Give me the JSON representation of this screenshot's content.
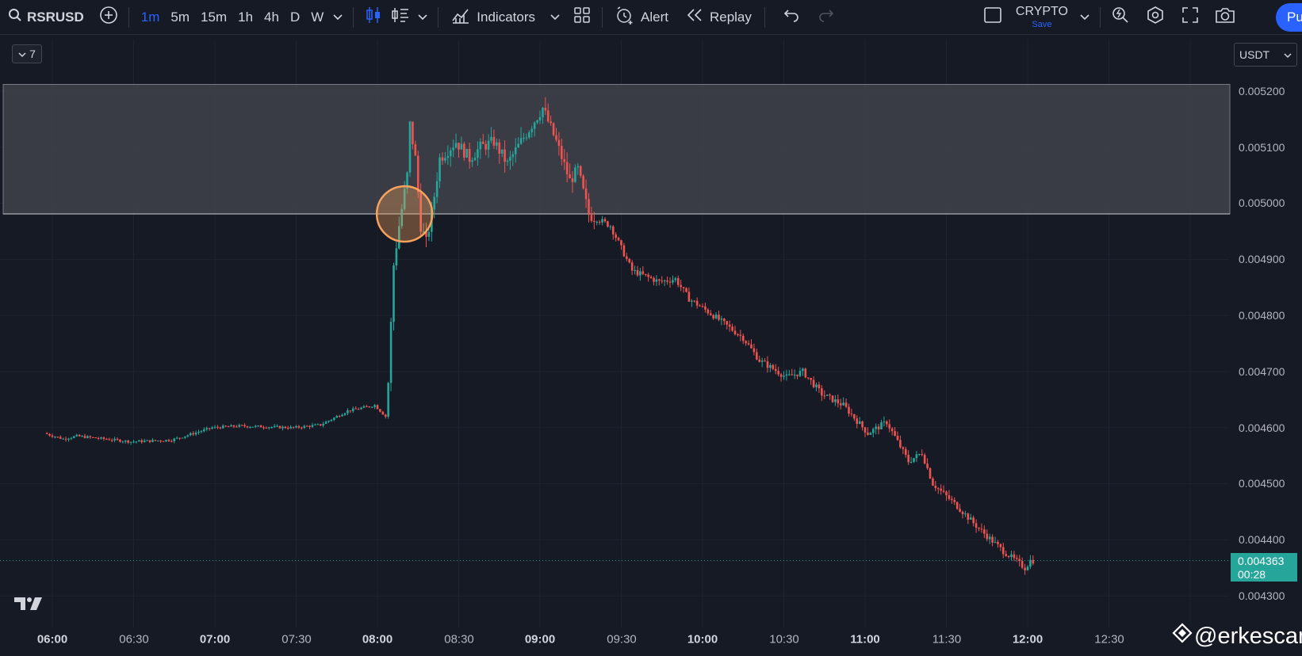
{
  "toolbar": {
    "symbol": "RSRUSD",
    "timeframes": [
      "1m",
      "5m",
      "15m",
      "1h",
      "4h",
      "D",
      "W"
    ],
    "active_timeframe": "1m",
    "indicators_label": "Indicators",
    "alert_label": "Alert",
    "replay_label": "Replay",
    "layout_name": "CRYPTO",
    "save_label": "Save",
    "publish_label": "Pu"
  },
  "legend_toggle": {
    "count": "7"
  },
  "currency_select": {
    "value": "USDT"
  },
  "price_axis": {
    "labels": [
      "0.005200",
      "0.005100",
      "0.005000",
      "0.004900",
      "0.004800",
      "0.004700",
      "0.004600",
      "0.004500",
      "0.004400",
      "0.004300"
    ]
  },
  "time_axis": {
    "labels": [
      "06:00",
      "06:30",
      "07:00",
      "07:30",
      "08:00",
      "08:30",
      "09:00",
      "09:30",
      "10:00",
      "10:30",
      "11:00",
      "11:30",
      "12:00",
      "12:30"
    ]
  },
  "current_price": {
    "price": "0.004363",
    "countdown": "00:28"
  },
  "watermark": {
    "handle": "@erkescan"
  },
  "colors": {
    "background": "#161a25",
    "up": "#26a69a",
    "down": "#ef5350",
    "zone": "#3f424b",
    "highlight": "#f7a35c",
    "accent": "#2962ff"
  },
  "chart_data": {
    "type": "candlestick",
    "ylim": [
      0.00428,
      0.00522
    ],
    "zone": {
      "top": 0.005212,
      "bottom": 0.004981
    },
    "highlight_marker": {
      "time": "08:10",
      "price": 0.004981
    },
    "anchors": [
      [
        "05:58",
        0.00459
      ],
      [
        "06:05",
        0.00458
      ],
      [
        "06:10",
        0.004585
      ],
      [
        "06:20",
        0.00458
      ],
      [
        "06:30",
        0.004575
      ],
      [
        "06:45",
        0.004578
      ],
      [
        "07:00",
        0.0046
      ],
      [
        "07:10",
        0.004603
      ],
      [
        "07:30",
        0.0046
      ],
      [
        "07:40",
        0.004605
      ],
      [
        "07:50",
        0.00463
      ],
      [
        "08:00",
        0.00464
      ],
      [
        "08:04",
        0.00462
      ],
      [
        "08:05",
        0.00468
      ],
      [
        "08:07",
        0.00489
      ],
      [
        "08:09",
        0.00496
      ],
      [
        "08:12",
        0.00505
      ],
      [
        "08:13",
        0.00514
      ],
      [
        "08:15",
        0.00508
      ],
      [
        "08:17",
        0.00496
      ],
      [
        "08:19",
        0.00493
      ],
      [
        "08:21",
        0.00498
      ],
      [
        "08:24",
        0.00508
      ],
      [
        "08:30",
        0.00511
      ],
      [
        "08:35",
        0.00508
      ],
      [
        "08:39",
        0.0051
      ],
      [
        "08:44",
        0.00511
      ],
      [
        "08:49",
        0.00507
      ],
      [
        "08:54",
        0.00511
      ],
      [
        "09:02",
        0.00517
      ],
      [
        "09:07",
        0.00511
      ],
      [
        "09:12",
        0.00504
      ],
      [
        "09:15",
        0.00506
      ],
      [
        "09:19",
        0.00498
      ],
      [
        "09:27",
        0.00496
      ],
      [
        "09:35",
        0.00488
      ],
      [
        "09:45",
        0.00486
      ],
      [
        "09:51",
        0.004865
      ],
      [
        "09:56",
        0.00483
      ],
      [
        "10:05",
        0.0048
      ],
      [
        "10:16",
        0.00476
      ],
      [
        "10:22",
        0.00472
      ],
      [
        "10:32",
        0.00469
      ],
      [
        "10:38",
        0.0047
      ],
      [
        "10:45",
        0.00466
      ],
      [
        "10:53",
        0.00464
      ],
      [
        "11:02",
        0.00459
      ],
      [
        "11:09",
        0.00461
      ],
      [
        "11:17",
        0.00454
      ],
      [
        "11:22",
        0.004555
      ],
      [
        "11:26",
        0.0045
      ],
      [
        "11:35",
        0.00446
      ],
      [
        "11:43",
        0.00442
      ],
      [
        "11:52",
        0.00438
      ],
      [
        "12:00",
        0.00435
      ],
      [
        "12:02",
        0.004363
      ]
    ]
  }
}
